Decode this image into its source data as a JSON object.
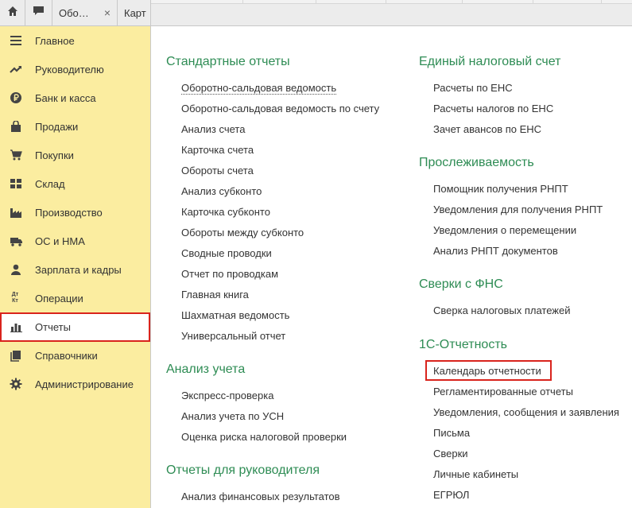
{
  "tabs": {
    "home_icon": "home-icon",
    "chat_icon": "chat-icon",
    "tab1_label": "Обо…",
    "tab1_close": "×",
    "tab2_label": "Карт"
  },
  "sidebar": {
    "items": [
      {
        "label": "Главное",
        "icon": "menu-icon"
      },
      {
        "label": "Руководителю",
        "icon": "trend-icon"
      },
      {
        "label": "Банк и касса",
        "icon": "ruble-icon"
      },
      {
        "label": "Продажи",
        "icon": "bag-icon"
      },
      {
        "label": "Покупки",
        "icon": "cart-icon"
      },
      {
        "label": "Склад",
        "icon": "grid-icon"
      },
      {
        "label": "Производство",
        "icon": "factory-icon"
      },
      {
        "label": "ОС и НМА",
        "icon": "truck-icon"
      },
      {
        "label": "Зарплата и кадры",
        "icon": "person-icon"
      },
      {
        "label": "Операции",
        "icon": "dt-kt-icon",
        "icon_text": "Дт Кт"
      },
      {
        "label": "Отчеты",
        "icon": "bar-chart-icon"
      },
      {
        "label": "Справочники",
        "icon": "book-icon"
      },
      {
        "label": "Администрирование",
        "icon": "gear-icon"
      }
    ]
  },
  "sections": {
    "standard": {
      "title": "Стандартные отчеты",
      "items": [
        "Оборотно-сальдовая ведомость",
        "Оборотно-сальдовая ведомость по счету",
        "Анализ счета",
        "Карточка счета",
        "Обороты счета",
        "Анализ субконто",
        "Карточка субконто",
        "Обороты между субконто",
        "Сводные проводки",
        "Отчет по проводкам",
        "Главная книга",
        "Шахматная ведомость",
        "Универсальный отчет"
      ]
    },
    "analysis": {
      "title": "Анализ учета",
      "items": [
        "Экспресс-проверка",
        "Анализ учета по УСН",
        "Оценка риска налоговой проверки"
      ]
    },
    "manager": {
      "title": "Отчеты для руководителя",
      "items": [
        "Анализ финансовых результатов"
      ]
    },
    "ens": {
      "title": "Единый налоговый счет",
      "items": [
        "Расчеты по ЕНС",
        "Расчеты налогов по ЕНС",
        "Зачет авансов по ЕНС"
      ]
    },
    "trace": {
      "title": "Прослеживаемость",
      "items": [
        "Помощник получения РНПТ",
        "Уведомления для получения РНПТ",
        "Уведомления о перемещении",
        "Анализ РНПТ документов"
      ]
    },
    "fns": {
      "title": "Сверки с ФНС",
      "items": [
        "Сверка налоговых платежей"
      ]
    },
    "reporting": {
      "title": "1С-Отчетность",
      "items": [
        "Календарь отчетности",
        "Регламентированные отчеты",
        "Уведомления, сообщения и заявления",
        "Письма",
        "Сверки",
        "Личные кабинеты",
        "ЕГРЮЛ"
      ]
    }
  },
  "colors": {
    "sidebar_bg": "#fbeda0",
    "section_title": "#2e8c54",
    "highlight": "#d9241d"
  }
}
